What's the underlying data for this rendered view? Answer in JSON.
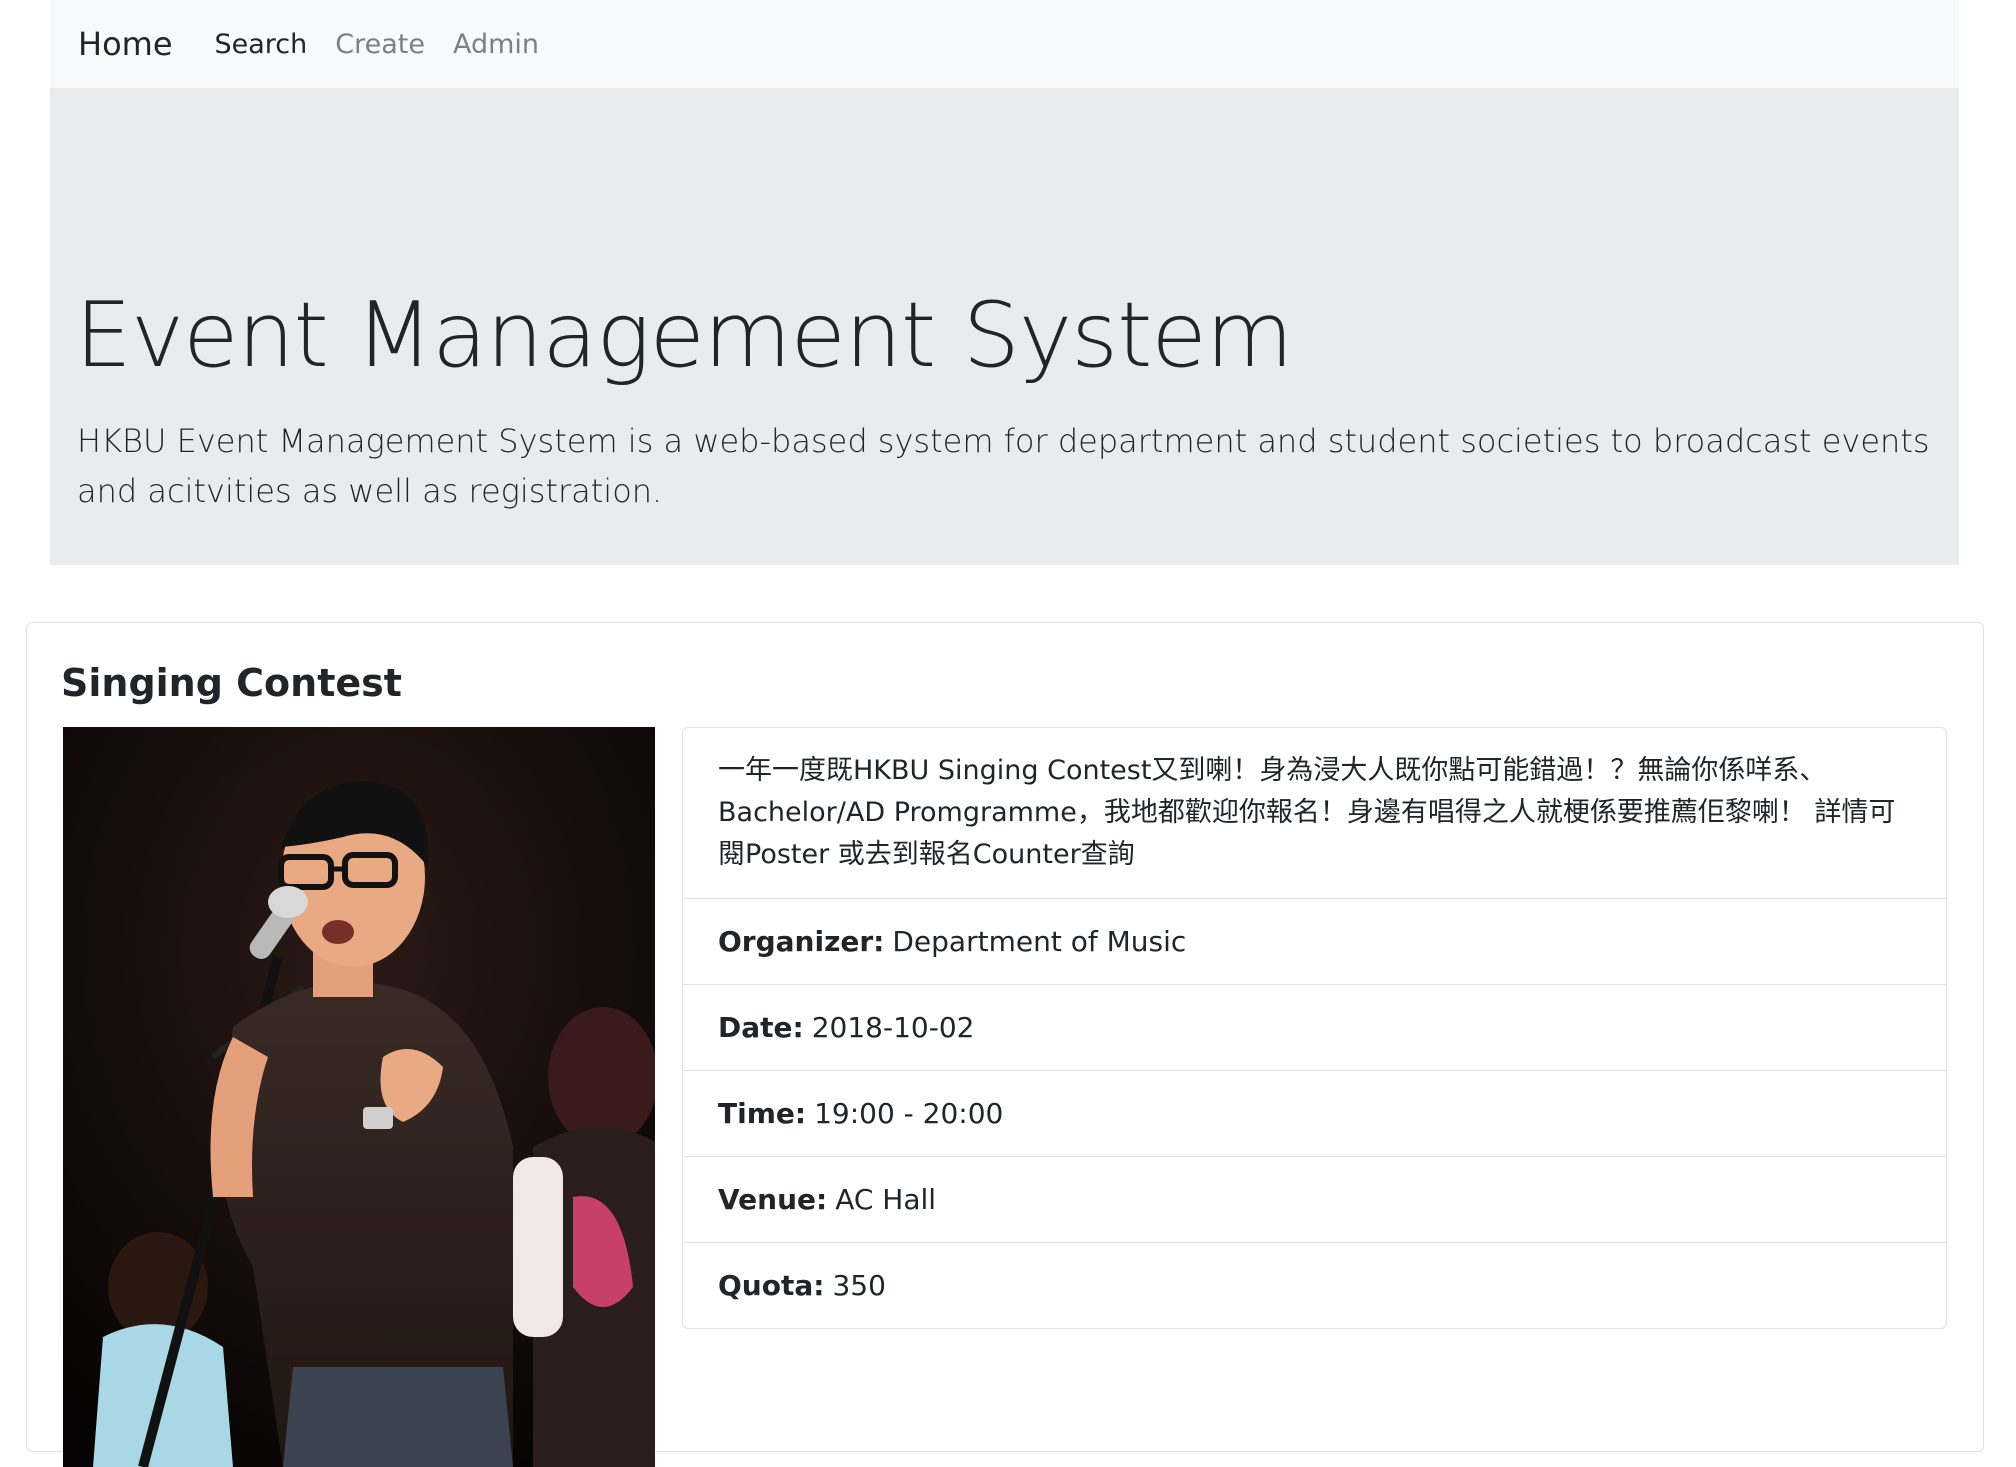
{
  "nav": {
    "brand": "Home",
    "links": [
      {
        "label": "Search"
      },
      {
        "label": "Create"
      },
      {
        "label": "Admin"
      }
    ]
  },
  "jumbotron": {
    "title": "Event Management System",
    "lead": "HKBU Event Management System is a web-based system for department and student societies to broadcast events and acitvities as well as registration."
  },
  "event": {
    "title": "Singing Contest",
    "description": "一年一度既HKBU Singing Contest又到喇！身為浸大人既你點可能錯過！？無論你係咩系、Bachelor/AD Promgramme，我地都歡迎你報名！身邊有唱得之人就梗係要推薦佢黎喇！ 詳情可閱Poster 或去到報名Counter查詢",
    "details": [
      {
        "label": "Organizer:",
        "value": "Department of Music"
      },
      {
        "label": "Date:",
        "value": "2018-10-02"
      },
      {
        "label": "Time:",
        "value": "19:00 - 20:00"
      },
      {
        "label": "Venue:",
        "value": "AC Hall"
      },
      {
        "label": "Quota:",
        "value": "350"
      }
    ]
  },
  "colors": {
    "navbar_bg": "#f8f9fa",
    "jumbotron_bg": "#e9ecef",
    "text": "#212529",
    "muted_link": "#7d7f82",
    "border": "#dfe1e3"
  }
}
